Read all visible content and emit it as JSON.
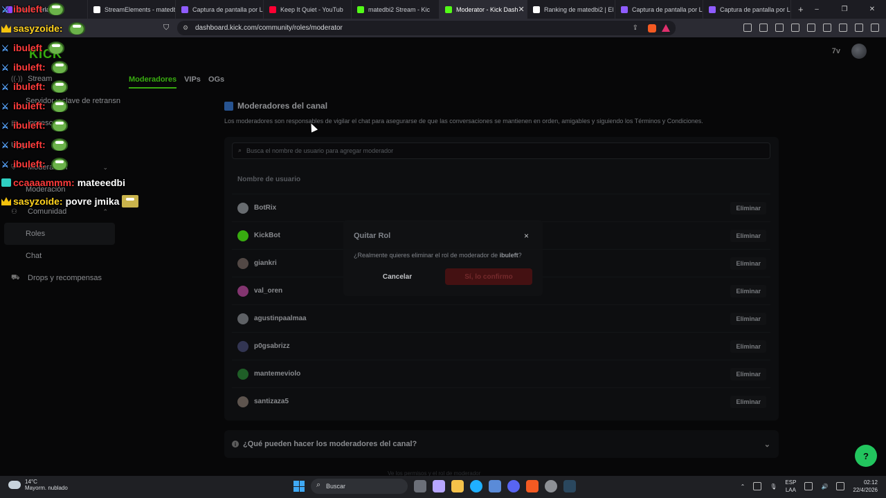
{
  "browser": {
    "tabs": [
      {
        "label": "Ibuleft · erlays",
        "color": "#9146ff"
      },
      {
        "label": "StreamElements - matedbi",
        "color": "#ffffff"
      },
      {
        "label": "Captura de pantalla por Li",
        "color": "#8f5cff"
      },
      {
        "label": "Keep It Quiet - YouTub",
        "color": "#ff0033"
      },
      {
        "label": "matedbi2 Stream - Kic",
        "color": "#53fc18"
      },
      {
        "label": "Moderator - Kick Dash",
        "color": "#53fc18",
        "active": true
      },
      {
        "label": "Ranking de matedbi2 | El",
        "color": "#ffffff"
      },
      {
        "label": "Captura de pantalla por Li",
        "color": "#8f5cff"
      },
      {
        "label": "Captura de pantalla por Li",
        "color": "#8f5cff"
      }
    ],
    "new_tab": "+",
    "url": "dashboard.kick.com/community/roles/moderator",
    "window_controls": [
      "–",
      "❐",
      "✕"
    ]
  },
  "header": {
    "logo": "KICK",
    "mark": "7v"
  },
  "sidebar": {
    "items": [
      {
        "label": "Stream",
        "icon": "broadcast-icon",
        "glyph": "((·))",
        "level": "top"
      },
      {
        "label": "Servidor y clave de retransn",
        "level": "sub"
      },
      {
        "label": "Ingresos",
        "icon": "revenue-icon",
        "glyph": "▤",
        "level": "top"
      },
      {
        "label": "Upgra",
        "level": "top"
      },
      {
        "label": "Moderación",
        "icon": "shield-icon",
        "glyph": "⛨",
        "level": "top",
        "chevron": "⌄"
      },
      {
        "label": "Moderación",
        "level": "sub"
      },
      {
        "label": "Comunidad",
        "icon": "community-icon",
        "glyph": "⚇",
        "level": "top",
        "chevron": "⌃"
      },
      {
        "label": "Roles",
        "level": "sub",
        "active": true
      },
      {
        "label": "Chat",
        "level": "sub"
      },
      {
        "label": "Drops y recompensas",
        "icon": "drops-icon",
        "glyph": "⛟",
        "level": "top"
      }
    ]
  },
  "role_tabs": [
    "Moderadores",
    "VIPs",
    "OGs"
  ],
  "main": {
    "title": "Moderadores del canal",
    "description": "Los moderadores son responsables de vigilar el chat para asegurarse de que las conversaciones se mantienen en orden, amigables y siguiendo los Términos y Condiciones.",
    "search_placeholder": "Busca el nombre de usuario para agregar moderador",
    "column_header": "Nombre de usuario",
    "remove_label": "Eliminar",
    "moderators": [
      {
        "name": "BotRix",
        "avatar_color": "#9aa0a6"
      },
      {
        "name": "KickBot",
        "avatar_color": "#53fc18"
      },
      {
        "name": "giankri",
        "avatar_color": "#7a6b66"
      },
      {
        "name": "val_oren",
        "avatar_color": "#c24fa6"
      },
      {
        "name": "agustinpaalmaa",
        "avatar_color": "#8b8f96"
      },
      {
        "name": "p0gsabrizz",
        "avatar_color": "#4b4f7a"
      },
      {
        "name": "mantemeviolo",
        "avatar_color": "#2e8b3a"
      },
      {
        "name": "santizaza5",
        "avatar_color": "#8a7c74"
      }
    ],
    "faq_question": "¿Qué pueden hacer los moderadores del canal?",
    "faq_icon": "i",
    "below_text": "Ve los permisos y el rol de moderador"
  },
  "modal": {
    "title": "Quitar Rol",
    "close": "×",
    "question_prefix": "¿Realmente quieres eliminar el rol de moderador de ",
    "target_user": "ibuleft",
    "question_suffix": "?",
    "cancel": "Cancelar",
    "confirm": "Sí, lo confirmo"
  },
  "chat_overlay": [
    {
      "user": "ibuleft",
      "badge": "sword",
      "user_color": "#ff3b3b",
      "emote": true
    },
    {
      "user": "sasyzoide:",
      "badge": "crown",
      "user_color": "#ffd21e",
      "emote": true
    },
    {
      "user": "ibuleft",
      "badge": "sword",
      "user_color": "#ff3b3b",
      "emote": true
    },
    {
      "user": "ibuleft:",
      "badge": "sword",
      "user_color": "#ff3b3b",
      "emote": true
    },
    {
      "user": "ibuleft:",
      "badge": "sword",
      "user_color": "#ff3b3b",
      "emote": true
    },
    {
      "user": "ibuleft:",
      "badge": "sword",
      "user_color": "#ff3b3b",
      "emote": true
    },
    {
      "user": "ibuleft:",
      "badge": "sword",
      "user_color": "#ff3b3b",
      "emote": true
    },
    {
      "user": "ibuleft:",
      "badge": "sword",
      "user_color": "#ff3b3b",
      "emote": true
    },
    {
      "user": "ibuleft:",
      "badge": "sword",
      "user_color": "#ff3b3b",
      "emote": true
    },
    {
      "user": "ccaaaammm:",
      "badge": "gift",
      "user_color": "#ff3b3b",
      "text": "mateeedbi"
    },
    {
      "user": "sasyzoide:",
      "badge": "crown",
      "user_color": "#ffd21e",
      "text": "povre jmika",
      "emote_square": true
    }
  ],
  "taskbar": {
    "temperature": "14°C",
    "weather": "Mayorm. nublado",
    "search": "Buscar",
    "lang_top": "ESP",
    "lang_bottom": "LAA",
    "time": "02:12",
    "date": "22/4/2026"
  }
}
